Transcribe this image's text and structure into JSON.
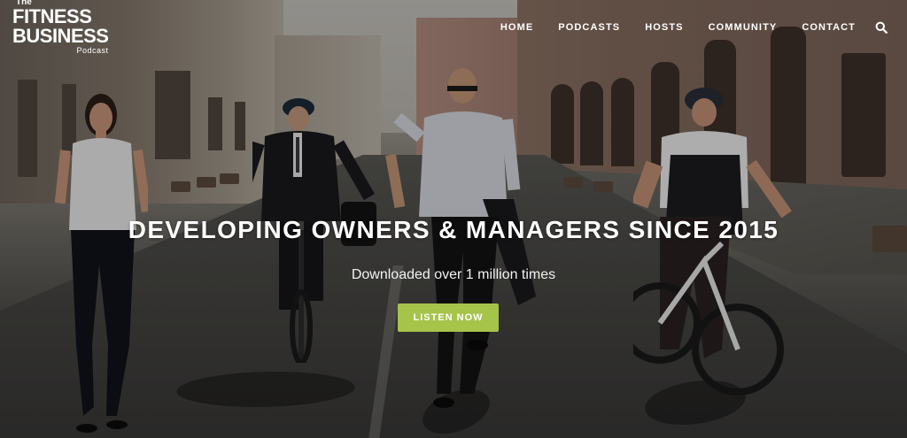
{
  "brand": {
    "logo_the": "The",
    "logo_line1": "FITNESS",
    "logo_line2": "BUSINESS",
    "logo_podcast": "Podcast"
  },
  "nav": {
    "items": [
      {
        "label": "HOME"
      },
      {
        "label": "PODCASTS"
      },
      {
        "label": "HOSTS"
      },
      {
        "label": "COMMUNITY"
      },
      {
        "label": "CONTACT"
      }
    ],
    "search_icon": "search-icon"
  },
  "hero": {
    "headline": "DEVELOPING OWNERS & MANAGERS SINCE 2015",
    "subheadline": "Downloaded over 1 million times",
    "cta_label": "LISTEN NOW",
    "cta_color": "#a6c34a",
    "image_description": "street-scene-people-walking-and-cycling"
  }
}
